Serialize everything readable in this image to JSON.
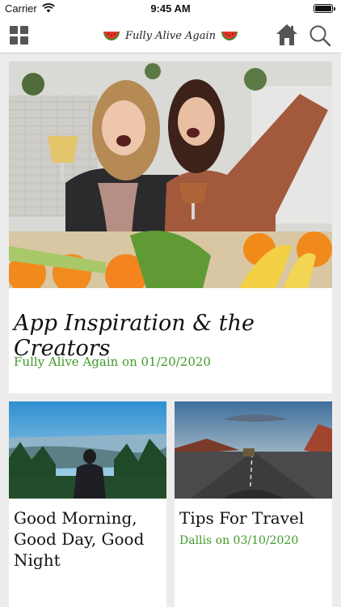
{
  "status_bar": {
    "carrier": "Carrier",
    "time": "9:45 AM"
  },
  "nav": {
    "app_title": "Fully Alive Again",
    "left_icon": "grid-menu-icon",
    "home_icon": "home-icon",
    "search_icon": "search-icon"
  },
  "feature": {
    "title": "App Inspiration & the Creators",
    "meta": "Fully Alive Again on 01/20/2020"
  },
  "cards": [
    {
      "title": "Good Morning, Good Day, Good Night",
      "meta": ""
    },
    {
      "title": "Tips For Travel",
      "meta": "Dallis on 03/10/2020"
    }
  ],
  "colors": {
    "meta_green": "#3f9a2a",
    "icon_gray": "#555555"
  }
}
